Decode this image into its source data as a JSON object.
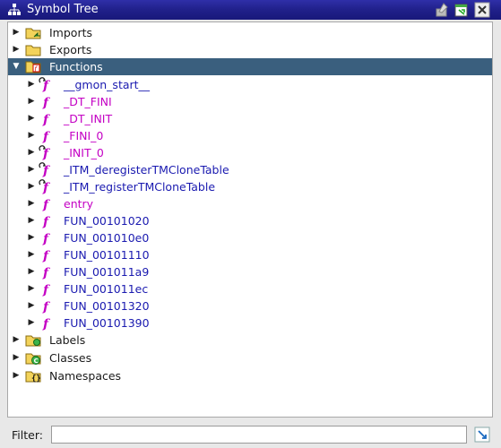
{
  "window": {
    "title": "Symbol Tree"
  },
  "tree": {
    "imports": "Imports",
    "exports": "Exports",
    "functions": "Functions",
    "function_items": [
      {
        "label": "__gmon_start__",
        "icon": "external-function-icon",
        "external": false
      },
      {
        "label": "_DT_FINI",
        "icon": "function-icon",
        "external": true
      },
      {
        "label": "_DT_INIT",
        "icon": "function-icon",
        "external": true
      },
      {
        "label": "_FINI_0",
        "icon": "function-icon",
        "external": true
      },
      {
        "label": "_INIT_0",
        "icon": "external-function-icon",
        "external": true
      },
      {
        "label": "_ITM_deregisterTMCloneTable",
        "icon": "external-function-icon",
        "external": false
      },
      {
        "label": "_ITM_registerTMCloneTable",
        "icon": "external-function-icon",
        "external": false
      },
      {
        "label": "entry",
        "icon": "function-icon",
        "external": true
      },
      {
        "label": "FUN_00101020",
        "icon": "function-icon",
        "external": false
      },
      {
        "label": "FUN_001010e0",
        "icon": "function-icon",
        "external": false
      },
      {
        "label": "FUN_00101110",
        "icon": "function-icon",
        "external": false
      },
      {
        "label": "FUN_001011a9",
        "icon": "function-icon",
        "external": false
      },
      {
        "label": "FUN_001011ec",
        "icon": "function-icon",
        "external": false
      },
      {
        "label": "FUN_00101320",
        "icon": "function-icon",
        "external": false
      },
      {
        "label": "FUN_00101390",
        "icon": "function-icon",
        "external": false
      }
    ],
    "labels": "Labels",
    "classes": "Classes",
    "namespaces": "Namespaces"
  },
  "filter": {
    "label": "Filter:",
    "value": ""
  },
  "colors": {
    "titlebar": "#20208a",
    "selection": "#3a5f7e",
    "function_text": "#1a1ab0",
    "thunk_text": "#c400c4",
    "function_icon": "#c400c4"
  }
}
